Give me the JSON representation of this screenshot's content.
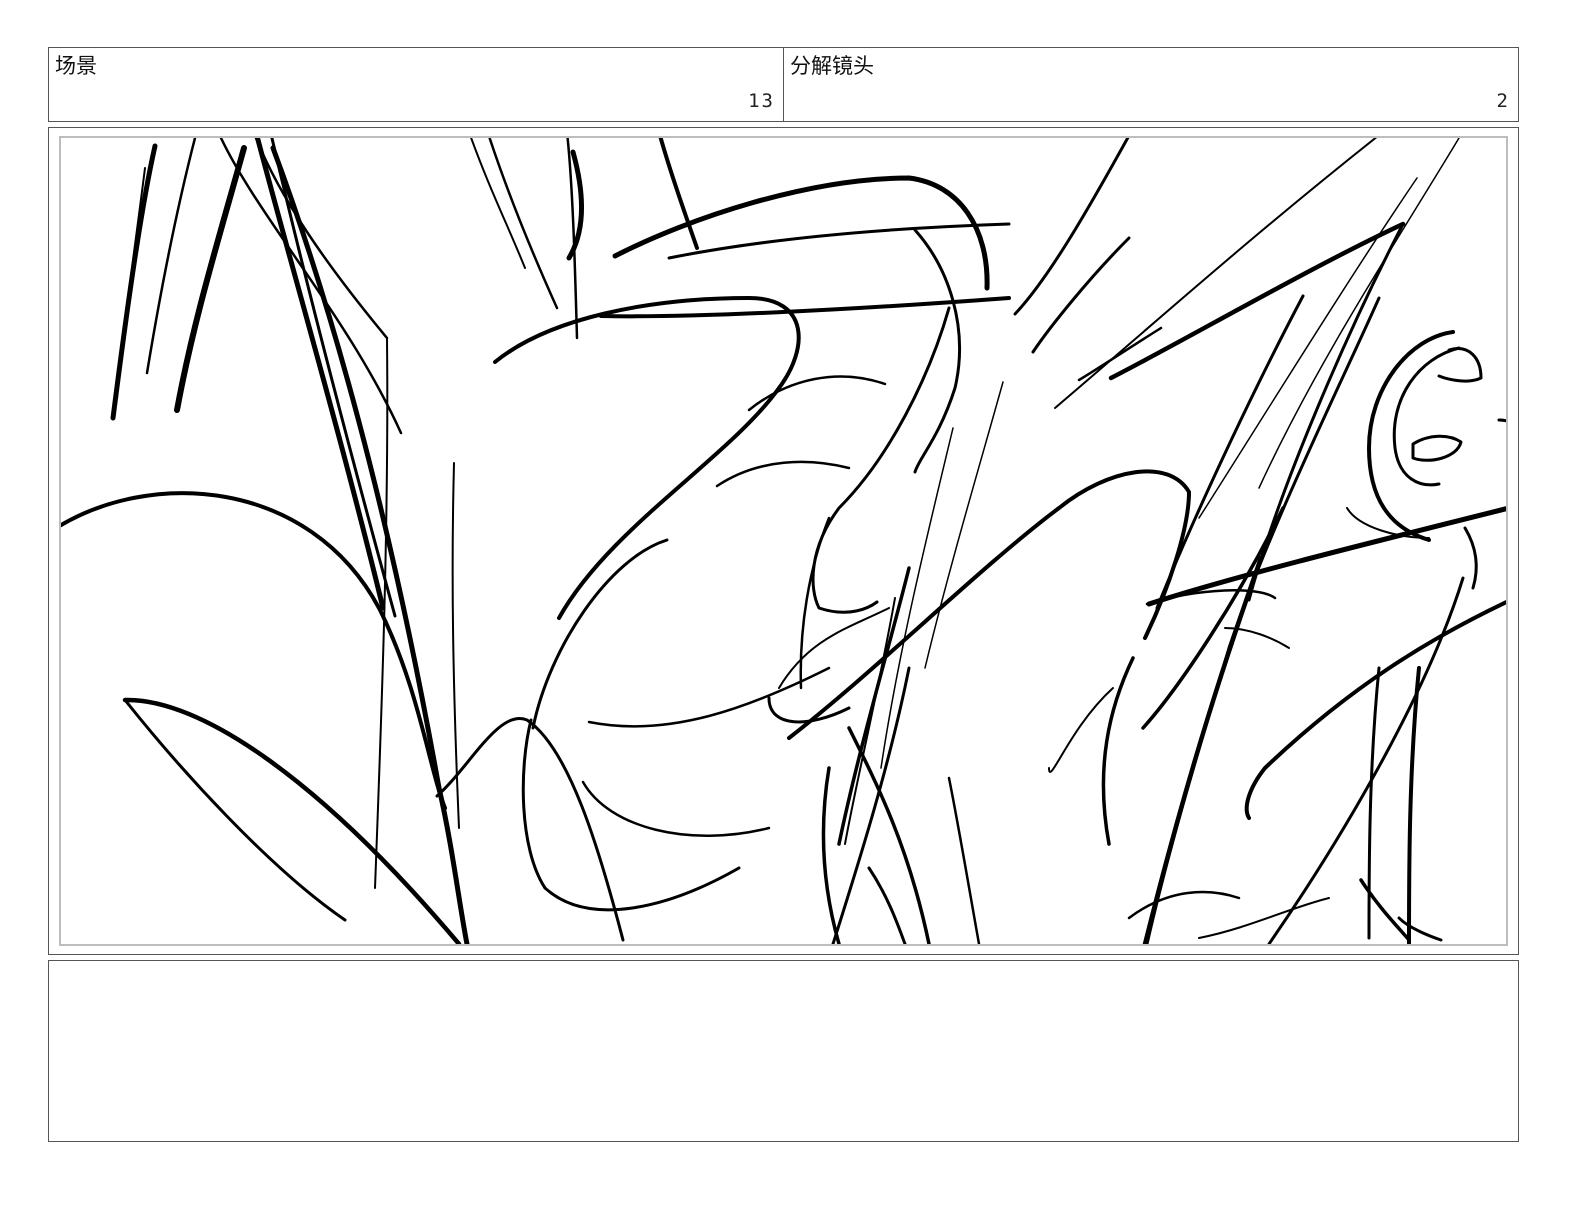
{
  "header": {
    "scene_label": "场景",
    "scene_number": "13",
    "shot_label": "分解镜头",
    "shot_number": "2"
  },
  "panel": {
    "sketch_icon": "rough-pencil-sketch",
    "stroke_color": "#000000",
    "frame_color": "#bdbdbd"
  },
  "notes": {
    "text": ""
  }
}
